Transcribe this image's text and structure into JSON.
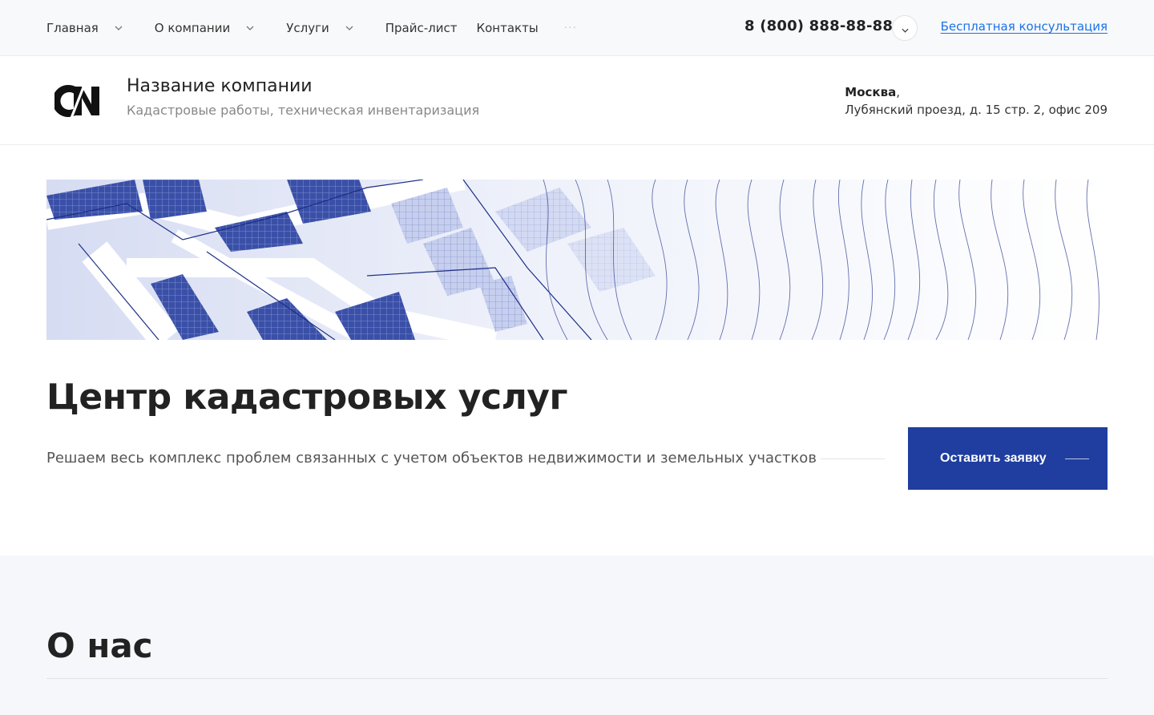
{
  "nav": {
    "items": [
      {
        "label": "Главная",
        "has_submenu": true
      },
      {
        "label": "О компании",
        "has_submenu": true
      },
      {
        "label": "Услуги",
        "has_submenu": true
      },
      {
        "label": "Прайс-лист",
        "has_submenu": false
      },
      {
        "label": "Контакты",
        "has_submenu": false
      }
    ],
    "more": "···",
    "phone": "8 (800) 888-88-88",
    "consult_link": "Бесплатная консультация"
  },
  "header": {
    "company_name": "Название компании",
    "company_desc": "Кадастровые работы, техническая инвентаризация",
    "address_city": "Москва",
    "address_sep": ",",
    "address_line": "Лубянский проезд, д. 15 стр. 2, офис 209"
  },
  "hero": {
    "title": "Центр кадастровых услуг",
    "subtitle": "Решаем весь комплекс проблем связанных с учетом объектов недвижимости и земельных участков",
    "cta_label": "Оставить заявку"
  },
  "about": {
    "title": "О нас"
  },
  "colors": {
    "accent": "#1f3ea0",
    "link": "#1a73e8",
    "banner_blue": "#2b3f9e"
  },
  "icons": [
    "chevron-down-icon",
    "company-logo",
    "arrow-line-icon"
  ]
}
